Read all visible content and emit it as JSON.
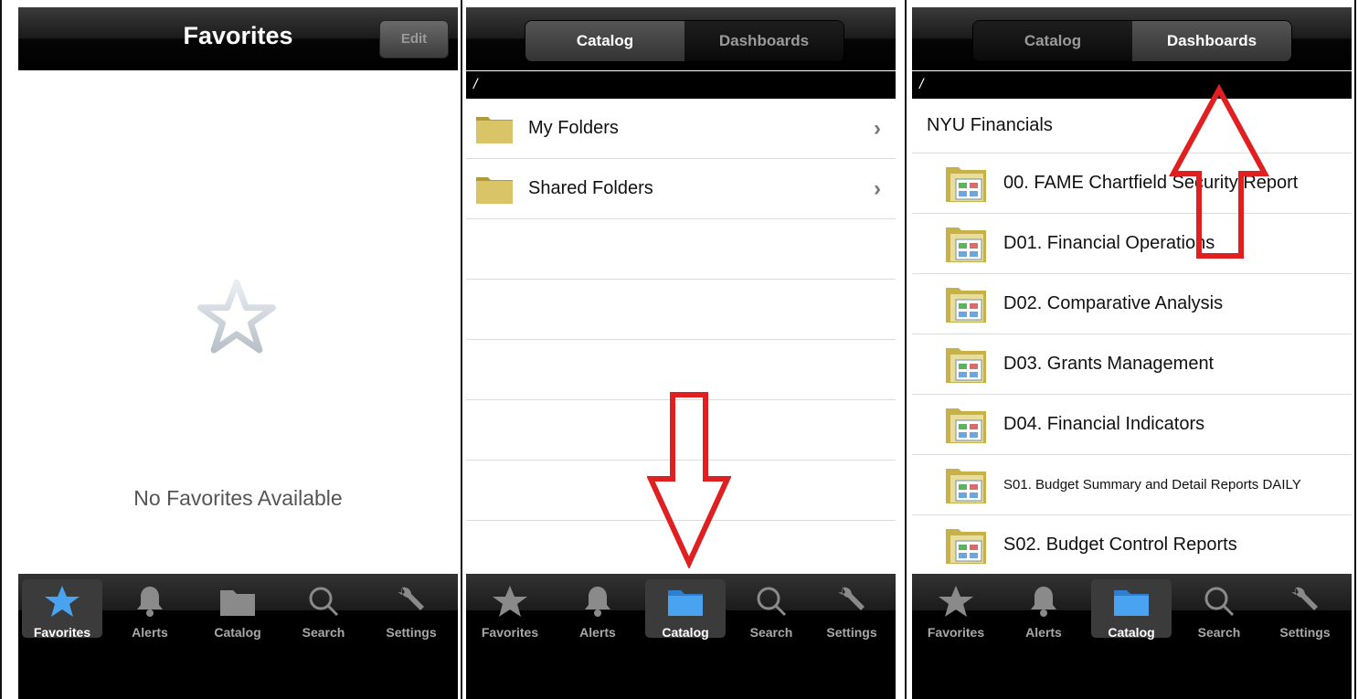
{
  "panel1": {
    "title": "Favorites",
    "edit_label": "Edit",
    "empty_text": "No Favorites Available"
  },
  "panel2": {
    "segments": [
      "Catalog",
      "Dashboards"
    ],
    "path": "/",
    "folders": [
      "My Folders",
      "Shared Folders"
    ]
  },
  "panel3": {
    "segments": [
      "Catalog",
      "Dashboards"
    ],
    "path": "/",
    "header": "NYU Financials",
    "items": [
      "00. FAME Chartfield Security Report",
      "D01. Financial Operations",
      "D02. Comparative Analysis",
      "D03. Grants Management",
      "D04. Financial Indicators",
      "S01. Budget Summary and Detail Reports DAILY",
      "S02. Budget Control Reports"
    ]
  },
  "tabs": [
    "Favorites",
    "Alerts",
    "Catalog",
    "Search",
    "Settings"
  ],
  "colors": {
    "accent_blue": "#4aa3f0",
    "arrow_red": "#e02020"
  }
}
